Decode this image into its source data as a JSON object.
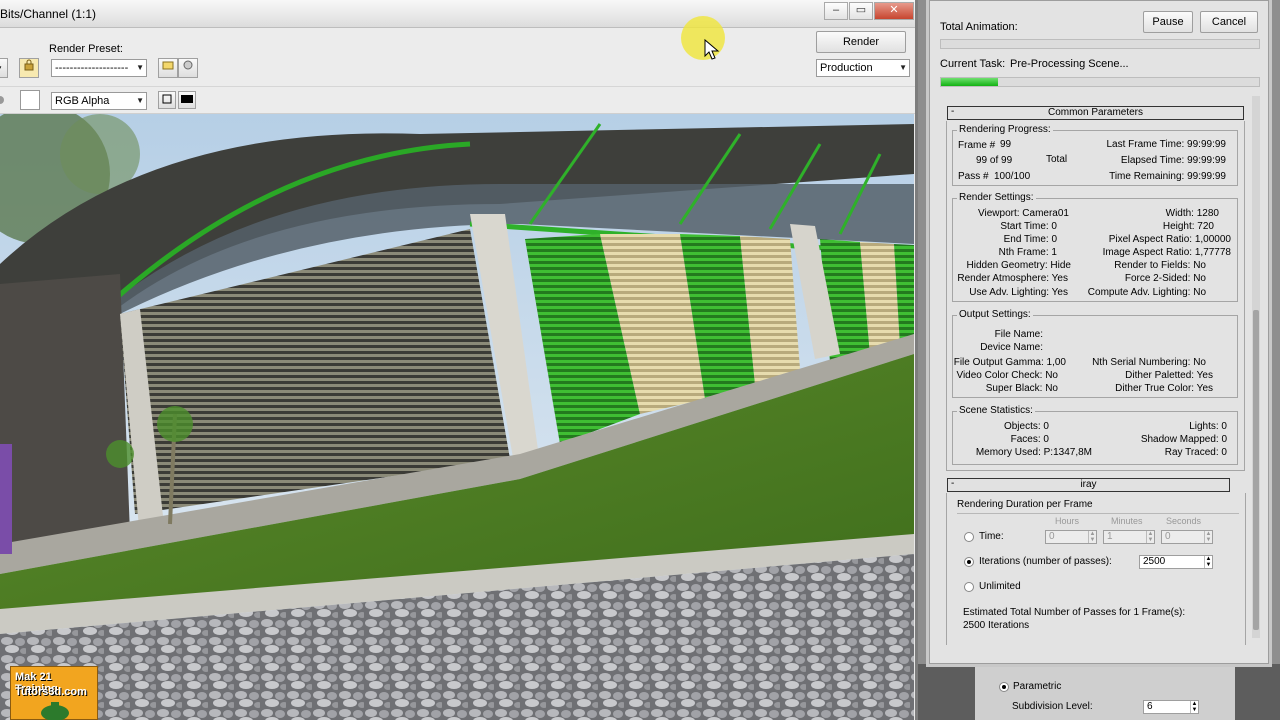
{
  "frame_window": {
    "title": "Bits/Channel (1:1)",
    "render_preset_label": "Render Preset:",
    "render_preset_value": "--------------------",
    "render_button": "Render",
    "production_value": "Production",
    "channel_value": "RGB Alpha"
  },
  "watermark": {
    "line1": "Mak 21 Training",
    "line2": "Tutors3d.com"
  },
  "progress": {
    "total_animation_label": "Total Animation:",
    "total_animation_fraction": 0.0,
    "pause_button": "Pause",
    "cancel_button": "Cancel",
    "current_task_label": "Current Task:",
    "current_task_value": "Pre-Processing Scene...",
    "current_task_fraction": 0.18,
    "accent_color": "#1fc01f"
  },
  "common": {
    "header": "Common Parameters",
    "rendering_progress": {
      "title": "Rendering Progress:",
      "frame_label": "Frame #",
      "frame_value": "99",
      "of_text": "99 of 99",
      "total_label": "Total",
      "pass_label": "Pass #",
      "pass_value": "100/100",
      "last_frame_time": "Last Frame Time: 99:99:99",
      "elapsed_time": "Elapsed Time: 99:99:99",
      "time_remaining": "Time Remaining: 99:99:99"
    },
    "render_settings": {
      "title": "Render Settings:",
      "left": [
        "Viewport: Camera01",
        "Start Time: 0",
        "End Time: 0",
        "Nth Frame: 1",
        "Hidden Geometry: Hide",
        "Render Atmosphere: Yes",
        "Use Adv. Lighting: Yes"
      ],
      "right": [
        "Width: 1280",
        "Height: 720",
        "Pixel Aspect Ratio: 1,00000",
        "Image Aspect Ratio: 1,77778",
        "Render to Fields: No",
        "Force 2-Sided: No",
        "Compute Adv. Lighting: No"
      ]
    },
    "output_settings": {
      "title": "Output Settings:",
      "file_name": "File Name:",
      "device_name": "Device Name:",
      "left": [
        "File Output Gamma: 1,00",
        "Video Color Check: No",
        "Super Black: No"
      ],
      "right": [
        "Nth Serial Numbering: No",
        "Dither Paletted: Yes",
        "Dither True Color: Yes"
      ]
    },
    "scene_statistics": {
      "title": "Scene Statistics:",
      "left": [
        "Objects: 0",
        "Faces: 0",
        "Memory Used: P:1347,8M"
      ],
      "right": [
        "Lights: 0",
        "Shadow Mapped: 0",
        "Ray Traced: 0"
      ]
    }
  },
  "iray": {
    "header": "iray",
    "duration_title": "Rendering Duration per Frame",
    "hours_label": "Hours",
    "minutes_label": "Minutes",
    "seconds_label": "Seconds",
    "time_label": "Time:",
    "hours_value": "0",
    "minutes_value": "1",
    "seconds_value": "0",
    "iterations_label": "Iterations (number of passes):",
    "iterations_value": "2500",
    "unlimited_label": "Unlimited",
    "estimate_line1": "Estimated Total Number of Passes for 1 Frame(s):",
    "estimate_line2": "2500 Iterations"
  },
  "behind": {
    "parametric_label": "Parametric",
    "subdivision_label": "Subdivision Level:",
    "subdivision_value": "6"
  }
}
